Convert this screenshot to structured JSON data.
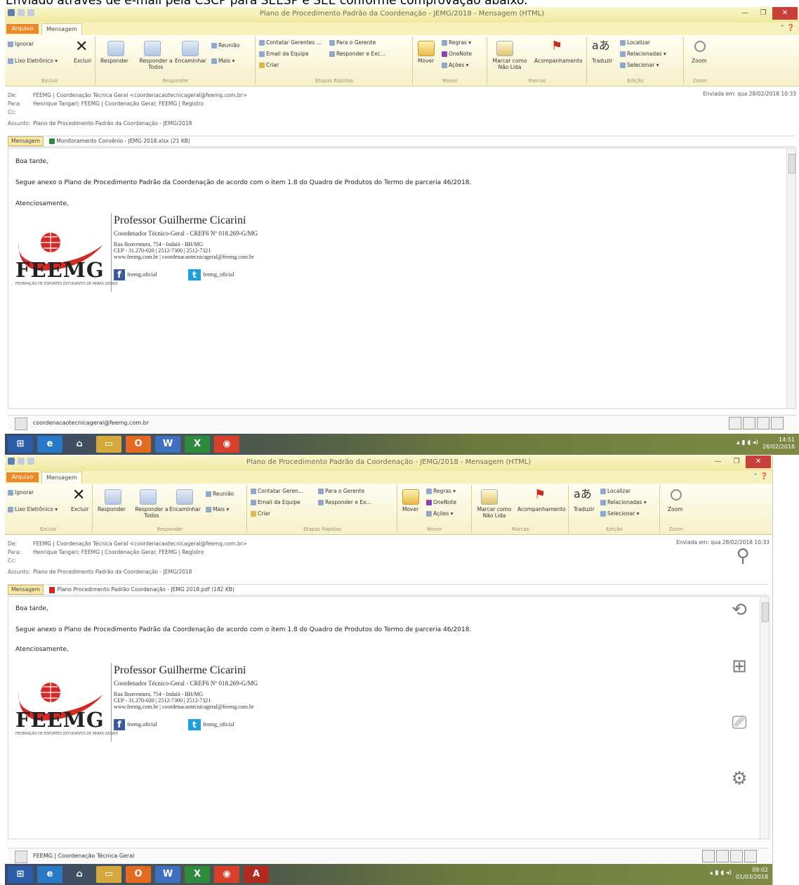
{
  "caption": "Enviado através de e-mail pela CSCP para SEESP e SEE conforme comprovação abaixo.",
  "shots": [
    {
      "window_title": "Plano de Procedimento Padrão da Coordenação - JEMG/2018 - Mensagem (HTML)",
      "tab_file": "Arquivo",
      "tab_message": "Mensagem",
      "groups": {
        "delete": "Excluir",
        "respond": "Responder",
        "quick_steps": "Etapas Rápidas",
        "move": "Mover",
        "tags": "Marcas",
        "editing": "Edição",
        "zoom": "Zoom"
      },
      "buttons": {
        "ignore": "Ignorar",
        "junk": "Lixo Eletrônico",
        "delete": "Excluir",
        "reply": "Responder",
        "reply_all": "Responder a Todos",
        "forward": "Encaminhar",
        "meeting": "Reunião",
        "more": "Mais",
        "contact_manager": "Contatar Gerentes ...",
        "to_manager": "Para o Gerente",
        "team_email": "Email da Equipe",
        "reply_delete": "Responder e Exc...",
        "create": "Criar",
        "move": "Mover",
        "rules": "Regras",
        "onenote": "OneNote",
        "actions": "Ações",
        "mark_unread": "Marcar como Não Lida",
        "followup": "Acompanhamento",
        "translate": "Traduzir",
        "find": "Localizar",
        "related": "Relacionadas",
        "select": "Selecionar",
        "zoom": "Zoom"
      },
      "from_label": "De:",
      "from": "FEEMG | Coordenação Técnica Geral <coordenacaotecnicageral@feemg.com.br>",
      "to_label": "Para:",
      "to": "Henrique Tangari; FEEMG | Coordenação Geral; FEEMG | Registro",
      "cc_label": "Cc:",
      "subject_label": "Assunto:",
      "subject": "Plano de Procedimento Padrão da Coordenação - JEMG/2018",
      "sent": "Enviada em:  qua 28/02/2018 10:33",
      "attach_tab": "Mensagem",
      "attachment": "Monitoramento Convênio - JEMG 2018.xlsx (21 KB)",
      "greeting": "Boa tarde,",
      "body_line": "Segue anexo o Plano de Procedimento Padrão da Coordenação de acordo com o item 1.8 do Quadro de Produtos do Termo de parceria 46/2018.",
      "closing": "Atenciosamente,",
      "people_name": "coordenacaotecnicageral@feemg.com.br",
      "clock_time": "14:51",
      "clock_date": "28/02/2018"
    },
    {
      "window_title": "Plano de Procedimento Padrão da Coordenação - JEMG/2018 - Mensagem (HTML)",
      "tab_file": "Arquivo",
      "tab_message": "Mensagem",
      "groups": {
        "delete": "Excluir",
        "respond": "Responder",
        "quick_steps": "Etapas Rápidas",
        "move": "Mover",
        "tags": "Marcas",
        "editing": "Edição",
        "zoom": "Zoom"
      },
      "buttons": {
        "ignore": "Ignorar",
        "junk": "Lixo Eletrônico",
        "delete": "Excluir",
        "reply": "Responder",
        "reply_all": "Responder a Todos",
        "forward": "Encaminhar",
        "meeting": "Reunião",
        "more": "Mais",
        "contact_manager": "Contatar Geren...",
        "to_manager": "Para o Gerente",
        "team_email": "Email da Equipe",
        "reply_delete": "Responder e Ex...",
        "create": "Criar",
        "move": "Mover",
        "rules": "Regras",
        "onenote": "OneNote",
        "actions": "Ações",
        "mark_unread": "Marcar como Não Lida",
        "followup": "Acompanhamento",
        "translate": "Traduzir",
        "find": "Localizar",
        "related": "Relacionadas",
        "select": "Selecionar",
        "zoom": "Zoom"
      },
      "from_label": "De:",
      "from": "FEEMG | Coordenação Técnica Geral <coordenacaotecnicageral@feemg.com.br>",
      "to_label": "Para:",
      "to": "Henrique Tangari; FEEMG | Coordenação Geral; FEEMG | Registro",
      "cc_label": "Cc:",
      "subject_label": "Assunto:",
      "subject": "Plano de Procedimento Padrão da Coordenação - JEMG/2018",
      "sent": "Enviada em:  qua 28/02/2018 10:33",
      "attach_tab": "Mensagem",
      "attachment": "Plano Procedimento Padrão Coordenação - JEMG 2018.pdf (182 KB)",
      "greeting": "Boa tarde,",
      "body_line": "Segue anexo o Plano de Procedimento Padrão da Coordenação de acordo com o item 1.8 do Quadro de Produtos do Termo de parceria 46/2018.",
      "closing": "Atenciosamente,",
      "people_name": "FEEMG | Coordenação Técnica Geral",
      "clock_time": "09:02",
      "clock_date": "01/03/2018"
    }
  ],
  "signature": {
    "name": "Professor Guilherme Cicarini",
    "role": "Coordenador Técnico-Geral - CREF6 Nº 018.269-G/MG",
    "address": "Rua Boaventura, 754 - Indaiá - BH/MG",
    "cep": "CEP - 31.270-020 | 2512-7300 | 2512-7321",
    "web": "www.feemg.com.br | coordenacaotecnicageral@feemg.com.br",
    "logo_text": "FEEMG",
    "logo_sub": "FEDERAÇÃO DE ESPORTES ESTUDANTIS DE MINAS GERAIS",
    "facebook": "feemg.oficial",
    "twitter": "feemg_oficial"
  },
  "colors": {
    "file_tab": "#e98a2c",
    "logo_red": "#d42a25",
    "flag": "#c62a22"
  }
}
